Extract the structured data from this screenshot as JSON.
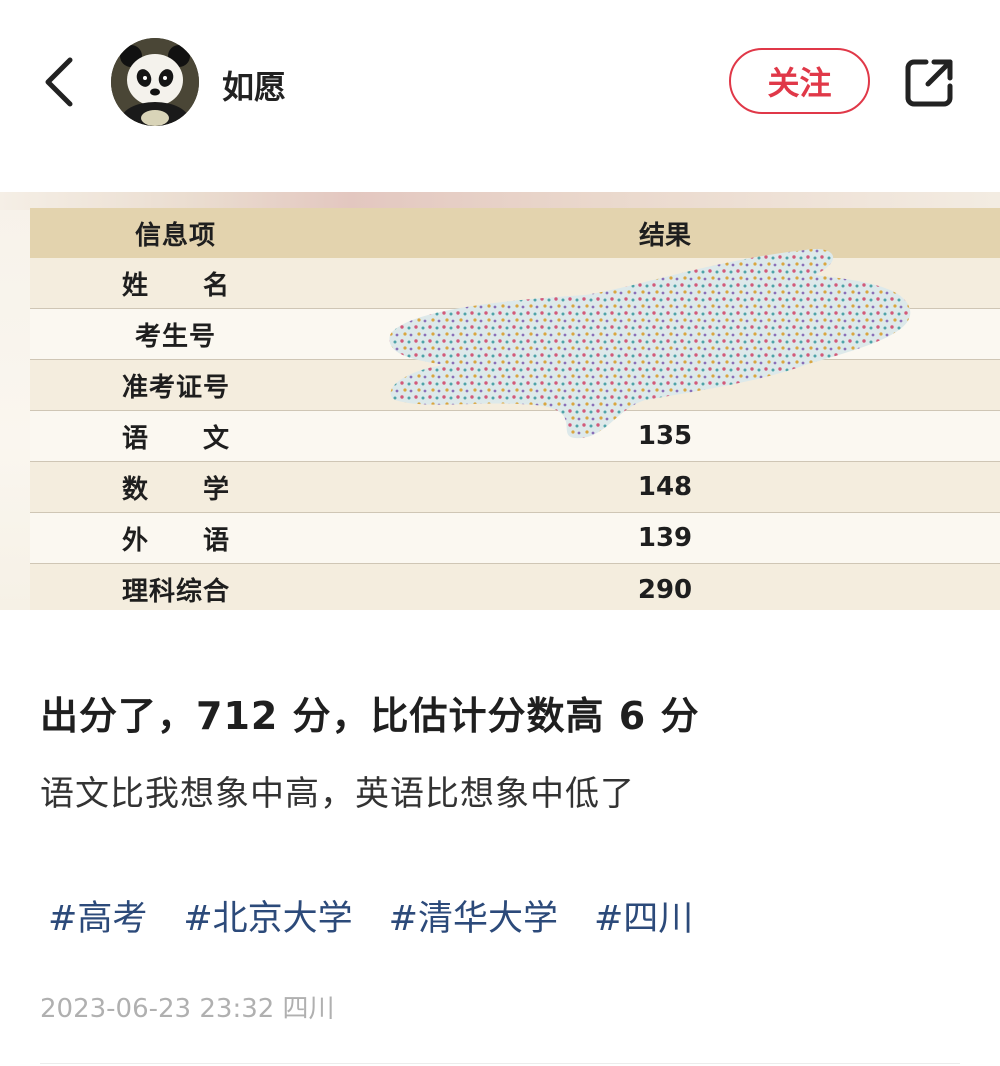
{
  "header": {
    "username": "如愿",
    "follow_label": "关注"
  },
  "icons": {
    "back": "chevron-left-icon",
    "share": "share-external-icon",
    "avatar": "panda-avatar"
  },
  "colors": {
    "accent": "#e03848",
    "tag": "#2c4a7a",
    "table_header": "#e3d3ae",
    "meta": "#b0b0b0"
  },
  "score_table": {
    "headers": [
      "信息项",
      "结果"
    ],
    "rows": [
      {
        "label": [
          "姓",
          "名"
        ],
        "value": ""
      },
      {
        "label": [
          "考生号"
        ],
        "value": ""
      },
      {
        "label": [
          "准考证号"
        ],
        "value": ""
      },
      {
        "label": [
          "语",
          "文"
        ],
        "value": "135"
      },
      {
        "label": [
          "数",
          "学"
        ],
        "value": "148"
      },
      {
        "label": [
          "外",
          "语"
        ],
        "value": "139"
      },
      {
        "label": [
          "理科综合"
        ],
        "value": "290"
      }
    ]
  },
  "post": {
    "title": "出分了，712 分，比估计分数高 6 分",
    "body": "语文比我想象中高，英语比想象中低了",
    "tags": [
      "#高考",
      "#北京大学",
      "#清华大学",
      "#四川"
    ],
    "meta": "2023-06-23 23:32 四川"
  }
}
